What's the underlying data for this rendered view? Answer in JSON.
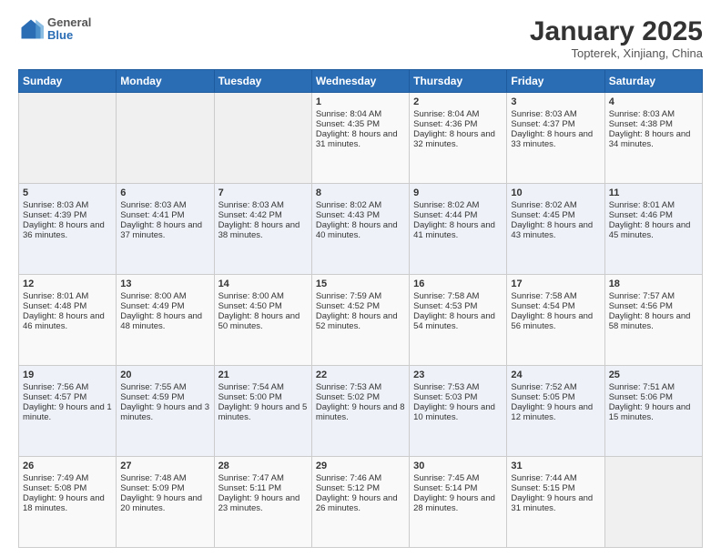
{
  "header": {
    "logo_general": "General",
    "logo_blue": "Blue",
    "month_title": "January 2025",
    "subtitle": "Topterek, Xinjiang, China"
  },
  "days_of_week": [
    "Sunday",
    "Monday",
    "Tuesday",
    "Wednesday",
    "Thursday",
    "Friday",
    "Saturday"
  ],
  "weeks": [
    [
      {
        "day": "",
        "content": ""
      },
      {
        "day": "",
        "content": ""
      },
      {
        "day": "",
        "content": ""
      },
      {
        "day": "1",
        "content": "Sunrise: 8:04 AM\nSunset: 4:35 PM\nDaylight: 8 hours and 31 minutes."
      },
      {
        "day": "2",
        "content": "Sunrise: 8:04 AM\nSunset: 4:36 PM\nDaylight: 8 hours and 32 minutes."
      },
      {
        "day": "3",
        "content": "Sunrise: 8:03 AM\nSunset: 4:37 PM\nDaylight: 8 hours and 33 minutes."
      },
      {
        "day": "4",
        "content": "Sunrise: 8:03 AM\nSunset: 4:38 PM\nDaylight: 8 hours and 34 minutes."
      }
    ],
    [
      {
        "day": "5",
        "content": "Sunrise: 8:03 AM\nSunset: 4:39 PM\nDaylight: 8 hours and 36 minutes."
      },
      {
        "day": "6",
        "content": "Sunrise: 8:03 AM\nSunset: 4:41 PM\nDaylight: 8 hours and 37 minutes."
      },
      {
        "day": "7",
        "content": "Sunrise: 8:03 AM\nSunset: 4:42 PM\nDaylight: 8 hours and 38 minutes."
      },
      {
        "day": "8",
        "content": "Sunrise: 8:02 AM\nSunset: 4:43 PM\nDaylight: 8 hours and 40 minutes."
      },
      {
        "day": "9",
        "content": "Sunrise: 8:02 AM\nSunset: 4:44 PM\nDaylight: 8 hours and 41 minutes."
      },
      {
        "day": "10",
        "content": "Sunrise: 8:02 AM\nSunset: 4:45 PM\nDaylight: 8 hours and 43 minutes."
      },
      {
        "day": "11",
        "content": "Sunrise: 8:01 AM\nSunset: 4:46 PM\nDaylight: 8 hours and 45 minutes."
      }
    ],
    [
      {
        "day": "12",
        "content": "Sunrise: 8:01 AM\nSunset: 4:48 PM\nDaylight: 8 hours and 46 minutes."
      },
      {
        "day": "13",
        "content": "Sunrise: 8:00 AM\nSunset: 4:49 PM\nDaylight: 8 hours and 48 minutes."
      },
      {
        "day": "14",
        "content": "Sunrise: 8:00 AM\nSunset: 4:50 PM\nDaylight: 8 hours and 50 minutes."
      },
      {
        "day": "15",
        "content": "Sunrise: 7:59 AM\nSunset: 4:52 PM\nDaylight: 8 hours and 52 minutes."
      },
      {
        "day": "16",
        "content": "Sunrise: 7:58 AM\nSunset: 4:53 PM\nDaylight: 8 hours and 54 minutes."
      },
      {
        "day": "17",
        "content": "Sunrise: 7:58 AM\nSunset: 4:54 PM\nDaylight: 8 hours and 56 minutes."
      },
      {
        "day": "18",
        "content": "Sunrise: 7:57 AM\nSunset: 4:56 PM\nDaylight: 8 hours and 58 minutes."
      }
    ],
    [
      {
        "day": "19",
        "content": "Sunrise: 7:56 AM\nSunset: 4:57 PM\nDaylight: 9 hours and 1 minute."
      },
      {
        "day": "20",
        "content": "Sunrise: 7:55 AM\nSunset: 4:59 PM\nDaylight: 9 hours and 3 minutes."
      },
      {
        "day": "21",
        "content": "Sunrise: 7:54 AM\nSunset: 5:00 PM\nDaylight: 9 hours and 5 minutes."
      },
      {
        "day": "22",
        "content": "Sunrise: 7:53 AM\nSunset: 5:02 PM\nDaylight: 9 hours and 8 minutes."
      },
      {
        "day": "23",
        "content": "Sunrise: 7:53 AM\nSunset: 5:03 PM\nDaylight: 9 hours and 10 minutes."
      },
      {
        "day": "24",
        "content": "Sunrise: 7:52 AM\nSunset: 5:05 PM\nDaylight: 9 hours and 12 minutes."
      },
      {
        "day": "25",
        "content": "Sunrise: 7:51 AM\nSunset: 5:06 PM\nDaylight: 9 hours and 15 minutes."
      }
    ],
    [
      {
        "day": "26",
        "content": "Sunrise: 7:49 AM\nSunset: 5:08 PM\nDaylight: 9 hours and 18 minutes."
      },
      {
        "day": "27",
        "content": "Sunrise: 7:48 AM\nSunset: 5:09 PM\nDaylight: 9 hours and 20 minutes."
      },
      {
        "day": "28",
        "content": "Sunrise: 7:47 AM\nSunset: 5:11 PM\nDaylight: 9 hours and 23 minutes."
      },
      {
        "day": "29",
        "content": "Sunrise: 7:46 AM\nSunset: 5:12 PM\nDaylight: 9 hours and 26 minutes."
      },
      {
        "day": "30",
        "content": "Sunrise: 7:45 AM\nSunset: 5:14 PM\nDaylight: 9 hours and 28 minutes."
      },
      {
        "day": "31",
        "content": "Sunrise: 7:44 AM\nSunset: 5:15 PM\nDaylight: 9 hours and 31 minutes."
      },
      {
        "day": "",
        "content": ""
      }
    ]
  ]
}
